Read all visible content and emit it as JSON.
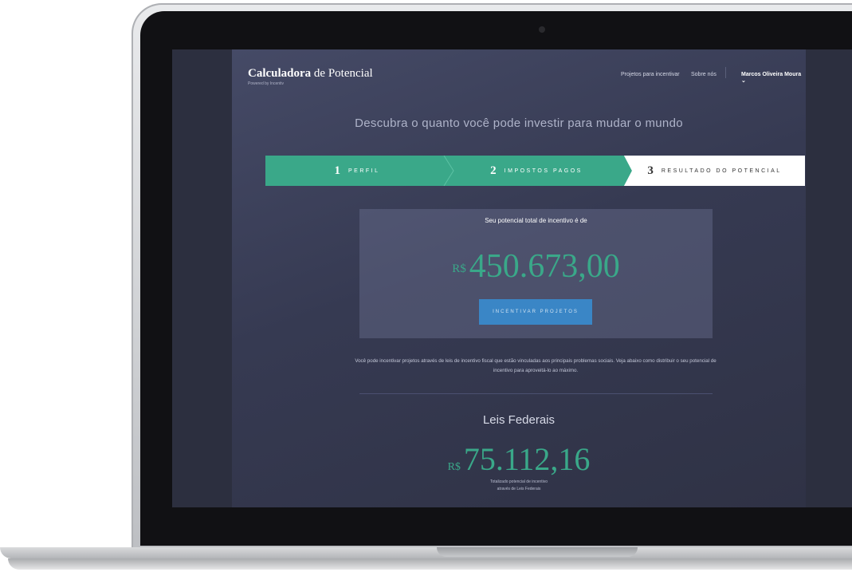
{
  "app": {
    "brand_bold": "Calculadora",
    "brand_rest": " de Potencial",
    "powered_by": "Powered by Incentiv"
  },
  "nav": {
    "projects": "Projetos para incentivar",
    "about": "Sobre nós",
    "user": "Marcos Oliveira Moura"
  },
  "headline": "Descubra o quanto você pode investir para mudar o mundo",
  "steps": [
    {
      "num": "1",
      "label": "PERFIL"
    },
    {
      "num": "2",
      "label": "IMPOSTOS PAGOS"
    },
    {
      "num": "3",
      "label": "RESULTADO DO POTENCIAL"
    }
  ],
  "result": {
    "title": "Seu potencial total de incentivo é de",
    "currency": "R$",
    "value": "450.673,00",
    "cta": "INCENTIVAR PROJETOS"
  },
  "description": "Você pode incentivar projetos através de leis de incentivo fiscal que estão vinculadas aos principais problemas sociais. Veja abaixo como distribuir o seu potencial de incentivo para aproveitá-lo ao máximo.",
  "federal": {
    "title": "Leis Federais",
    "currency": "R$",
    "value": "75.112,16",
    "note_line1": "Totalizado potencial de incentivo",
    "note_line2": "através de Leis Federais"
  },
  "colors": {
    "accent_green": "#3aa889",
    "cta_blue": "#3a86c6",
    "background": "#363a52"
  }
}
